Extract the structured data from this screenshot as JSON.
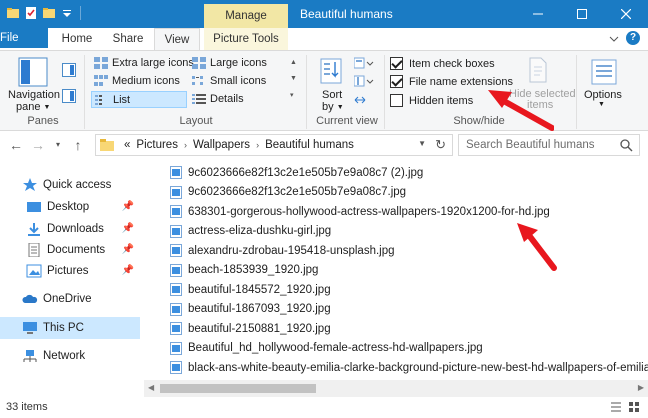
{
  "window": {
    "title": "Beautiful humans",
    "context_tab": "Manage",
    "accent": "#1a7bc4"
  },
  "ribbon_tabs": [
    "File",
    "Home",
    "Share",
    "View",
    "Picture Tools"
  ],
  "ribbon": {
    "panes": {
      "navigation_pane": "Navigation",
      "navigation_pane_2": "pane",
      "group": "Panes"
    },
    "layout": {
      "options": [
        "Extra large icons",
        "Large icons",
        "Medium icons",
        "Small icons",
        "List",
        "Details"
      ],
      "selected": "List",
      "group": "Layout"
    },
    "current_view": {
      "sort_by": "Sort",
      "sort_by_2": "by",
      "group": "Current view"
    },
    "show_hide": {
      "item_check_boxes": "Item check boxes",
      "file_name_extensions": "File name extensions",
      "hidden_items": "Hidden items",
      "hide_selected": "Hide selected",
      "hide_selected_2": "items",
      "group": "Show/hide"
    },
    "options": "Options"
  },
  "address": {
    "prefix": "«",
    "crumbs": [
      "Pictures",
      "Wallpapers",
      "Beautiful humans"
    ],
    "search_placeholder": "Search Beautiful humans"
  },
  "nav_pane": {
    "quick_access": "Quick access",
    "desktop": "Desktop",
    "downloads": "Downloads",
    "documents": "Documents",
    "pictures": "Pictures",
    "onedrive": "OneDrive",
    "this_pc": "This PC",
    "network": "Network"
  },
  "files": [
    "9c6023666e82f13c2e1e505b7e9a08c7 (2).jpg",
    "9c6023666e82f13c2e1e505b7e9a08c7.jpg",
    "638301-gorgerous-hollywood-actress-wallpapers-1920x1200-for-hd.jpg",
    "actress-eliza-dushku-girl.jpg",
    "alexandru-zdrobau-195418-unsplash.jpg",
    "beach-1853939_1920.jpg",
    "beautiful-1845572_1920.jpg",
    "beautiful-1867093_1920.jpg",
    "beautiful-2150881_1920.jpg",
    "Beautiful_hd_hollywood-female-actress-hd-wallpapers.jpg",
    "black-ans-white-beauty-emilia-clarke-background-picture-new-best-hd-wallpapers-of-emilia-cla"
  ],
  "status": {
    "item_count": "33 items"
  },
  "colors": {
    "arrow": "#e8171e",
    "selection": "#cce8ff"
  }
}
